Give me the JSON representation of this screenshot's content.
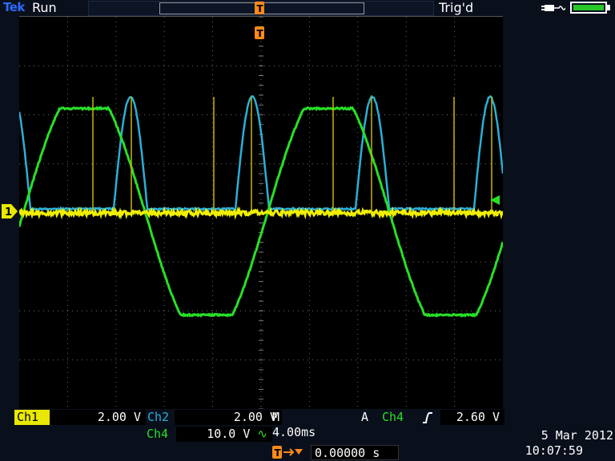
{
  "header": {
    "brand": "Tek",
    "acq_state": "Run",
    "trigger_status": "Trig'd"
  },
  "colors": {
    "ch1": "#e8e800",
    "ch2": "#2ab0d8",
    "ch4": "#27e027",
    "trigger": "#ff8a1a"
  },
  "markers": {
    "ch1_ground": "1",
    "trigger_position": "T"
  },
  "icons": [
    "plug-icon",
    "battery-icon",
    "trigger-position-icon"
  ],
  "battery_level": 1.0,
  "channels": {
    "ch1": {
      "label": "Ch1",
      "scale": "2.00 V"
    },
    "ch2": {
      "label": "Ch2",
      "scale": "2.00 V"
    },
    "ch4": {
      "label": "Ch4",
      "scale": "10.0 V",
      "coupling": "∿"
    }
  },
  "timebase": "M 4.00ms",
  "trigger": {
    "mode": "A",
    "source": "Ch4",
    "slope": "∩",
    "level": "2.60 V"
  },
  "trigger_position": "0.00000 s",
  "date": "5 Mar  2012",
  "time": "10:07:59"
}
